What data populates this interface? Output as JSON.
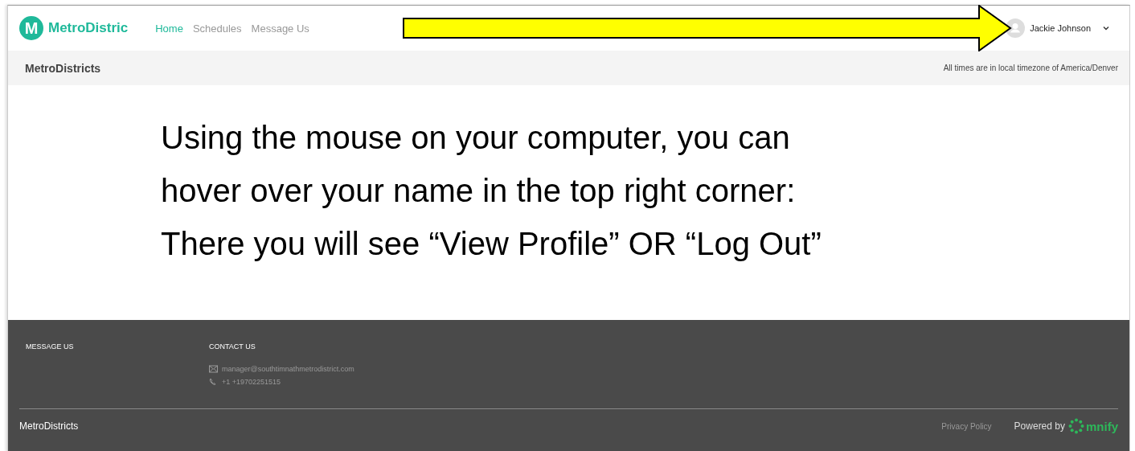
{
  "header": {
    "logo_letter": "M",
    "brand": "MetroDistric",
    "nav": [
      {
        "label": "Home",
        "selected": true
      },
      {
        "label": "Schedules",
        "selected": false
      },
      {
        "label": "Message Us",
        "selected": false
      }
    ],
    "user": {
      "name": "Jackie Johnson"
    }
  },
  "subheader": {
    "title": "MetroDistricts",
    "timezone_note": "All times are in local timezone of America/Denver"
  },
  "instructions": [
    "Using the mouse on your computer, you can",
    "hover over your name in the top right corner:",
    "There you will see “View Profile” OR “Log Out”"
  ],
  "footer": {
    "message_heading": "MESSAGE US",
    "contact_heading": "CONTACT US",
    "email": "manager@southtimnathmetrodistrict.com",
    "phone": "+1 +19702251515",
    "site_name": "MetroDistricts",
    "privacy_link": "Privacy Policy",
    "powered_by": "Powered by",
    "powered_brand": "mnify"
  }
}
